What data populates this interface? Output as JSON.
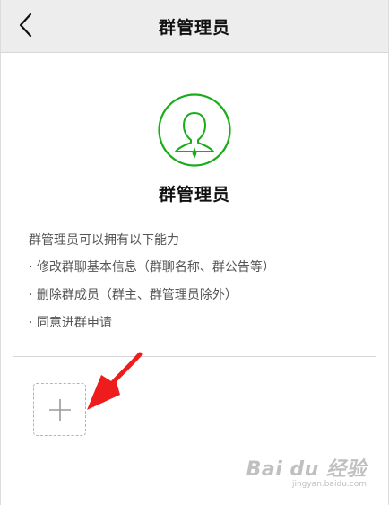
{
  "header": {
    "title": "群管理员",
    "back_icon": "chevron-left-icon"
  },
  "role": {
    "icon": "admin-avatar-icon",
    "title": "群管理员",
    "accent_color": "#1aad19"
  },
  "description": {
    "heading": "群管理员可以拥有以下能力",
    "items": [
      "· 修改群聊基本信息（群聊名称、群公告等）",
      "· 删除群成员（群主、群管理员除外）",
      "· 同意进群申请"
    ]
  },
  "actions": {
    "add_icon": "plus-icon"
  },
  "annotation": {
    "arrow_icon": "red-arrow-icon",
    "color": "#ee1c1c"
  },
  "watermark": {
    "logo": "Bai du 经验",
    "url": "jingyan.baidu.com"
  }
}
